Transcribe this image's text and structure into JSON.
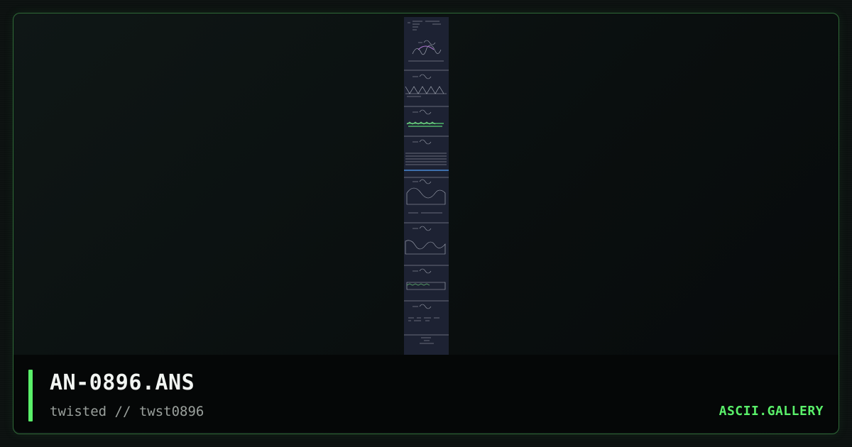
{
  "artwork": {
    "filename": "AN-0896.ANS",
    "meta": "twisted // twst0896"
  },
  "site": {
    "brand": "ASCII.GALLERY"
  },
  "colors": {
    "accent": "#5af06a",
    "frame_border": "#2f6a37",
    "preview_background": "#1d2233",
    "info_bar_background": "#050707"
  }
}
